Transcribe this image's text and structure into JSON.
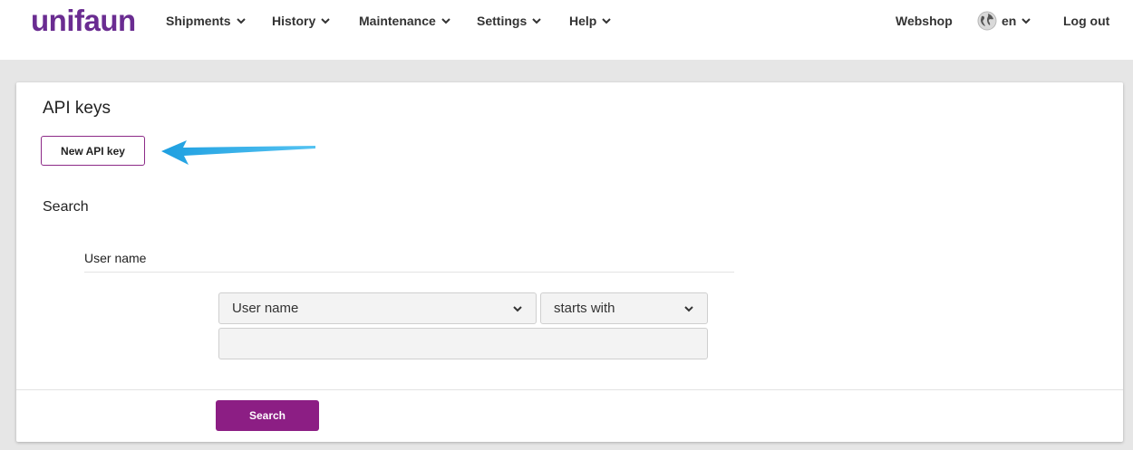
{
  "brand": {
    "logo_text": "unifaun",
    "color": "#6a2c91"
  },
  "nav": {
    "items": [
      {
        "label": "Shipments",
        "icon": "chevron-down-icon"
      },
      {
        "label": "History",
        "icon": "chevron-down-icon"
      },
      {
        "label": "Maintenance",
        "icon": "chevron-down-icon"
      },
      {
        "label": "Settings",
        "icon": "chevron-down-icon"
      },
      {
        "label": "Help",
        "icon": "chevron-down-icon"
      }
    ],
    "right": {
      "webshop_label": "Webshop",
      "language_label": "en",
      "language_icon": "globe-icon",
      "logout_label": "Log out"
    }
  },
  "page": {
    "title": "API keys",
    "new_button_label": "New API key",
    "annotation": "arrow-pointing-left-icon"
  },
  "search": {
    "title": "Search",
    "field_label": "User name",
    "field_select_value": "User name",
    "operator_select_value": "starts with",
    "value_input": "",
    "submit_label": "Search"
  },
  "colors": {
    "accent": "#8c1e84",
    "band": "#e6e6e6",
    "arrow": "#1ea0e0"
  }
}
